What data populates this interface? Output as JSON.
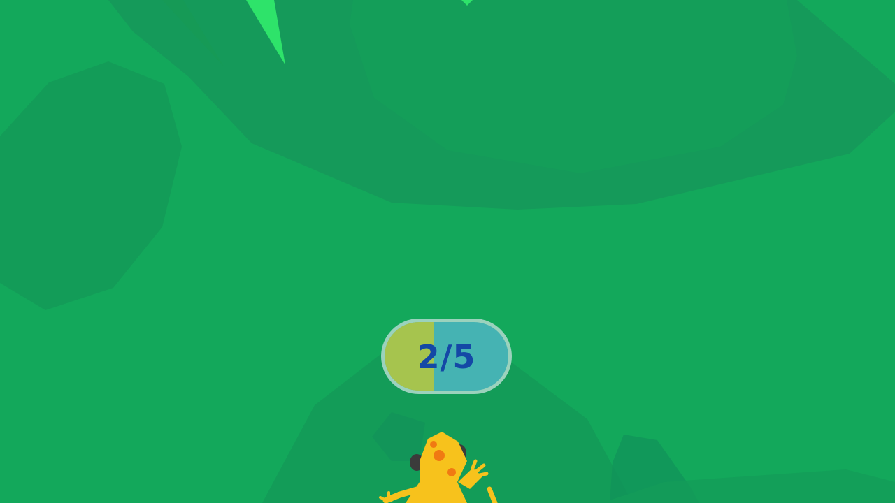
{
  "hud": {
    "progress_text": "2/5",
    "progress_current": 2,
    "progress_total": 5,
    "progress_fill_fraction": 0.4
  },
  "colors": {
    "ground": "#13a85b",
    "terrain_shadow": "#16985a",
    "grass_blade": "#2ee36a",
    "pill_fill": "#a6c44e",
    "pill_background": "#45b3b3",
    "pill_text": "#1448a6",
    "gecko": "#f7c21c",
    "gecko_spots": "#f07a12"
  },
  "scene": {
    "player_icon": "gecko-icon",
    "plant_icon": "grass-blade-icon"
  }
}
